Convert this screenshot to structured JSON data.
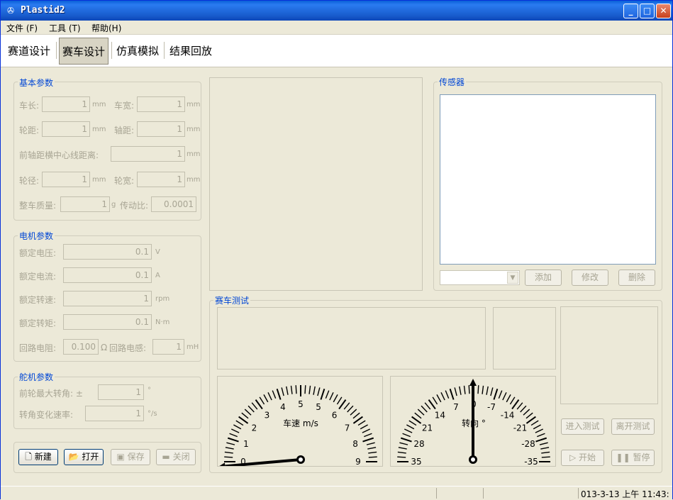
{
  "window": {
    "title": "Plastid2"
  },
  "menu": [
    "文件 (F)",
    "工具 (T)",
    "帮助(H)"
  ],
  "tabs": [
    "赛道设计",
    "赛车设计",
    "仿真模拟",
    "结果回放"
  ],
  "basic": {
    "legend": "基本参数",
    "length_label": "车长:",
    "length_value": "1",
    "length_unit": "mm",
    "width_label": "车宽:",
    "width_value": "1",
    "width_unit": "mm",
    "track_label": "轮距:",
    "track_value": "1",
    "track_unit": "mm",
    "wheelbase_label": "轴距:",
    "wheelbase_value": "1",
    "wheelbase_unit": "mm",
    "front_axle_label": "前轴距横中心线距离:",
    "front_axle_value": "1",
    "front_axle_unit": "mm",
    "wheel_dia_label": "轮径:",
    "wheel_dia_value": "1",
    "wheel_dia_unit": "mm",
    "wheel_width_label": "轮宽:",
    "wheel_width_value": "1",
    "wheel_width_unit": "mm",
    "mass_label": "整车质量:",
    "mass_value": "1",
    "mass_unit": "g",
    "ratio_label": "传动比:",
    "ratio_value": "0.0001"
  },
  "motor": {
    "legend": "电机参数",
    "voltage_label": "额定电压:",
    "voltage_value": "0.1",
    "voltage_unit": "V",
    "current_label": "额定电流:",
    "current_value": "0.1",
    "current_unit": "A",
    "speed_label": "额定转速:",
    "speed_value": "1",
    "speed_unit": "rpm",
    "torque_label": "额定转矩:",
    "torque_value": "0.1",
    "torque_unit": "N·m",
    "resistance_label": "回路电阻:",
    "resistance_value": "0.100",
    "resistance_unit": "Ω",
    "inductance_label": "回路电感:",
    "inductance_value": "1",
    "inductance_unit": "mH"
  },
  "servo": {
    "legend": "舵机参数",
    "max_angle_label": "前轮最大转角: ±",
    "max_angle_value": "1",
    "max_angle_unit": "°",
    "rate_label": "转角变化速率:",
    "rate_value": "1",
    "rate_unit": "°/s"
  },
  "file_buttons": {
    "new": "新建",
    "open": "打开",
    "save": "保存",
    "close": "关闭"
  },
  "sensor": {
    "legend": "传感器",
    "add": "添加",
    "edit": "修改",
    "delete": "删除"
  },
  "test": {
    "legend": "赛车测试",
    "enter": "进入测试",
    "leave": "离开测试",
    "start": "开始",
    "pause": "暂停"
  },
  "speed_gauge": {
    "label": "车速 m/s",
    "ticks": [
      "0",
      "1",
      "2",
      "3",
      "4",
      "5",
      "5",
      "6",
      "7",
      "8",
      "9"
    ],
    "needle_value": 0
  },
  "steer_gauge": {
    "label": "转向 °",
    "ticks": [
      "35",
      "28",
      "21",
      "14",
      "7",
      "0",
      "-7",
      "-14",
      "-21",
      "-28",
      "-35"
    ],
    "needle_value": 0
  },
  "status": {
    "datetime": "013-3-13 上午 11:43:"
  }
}
